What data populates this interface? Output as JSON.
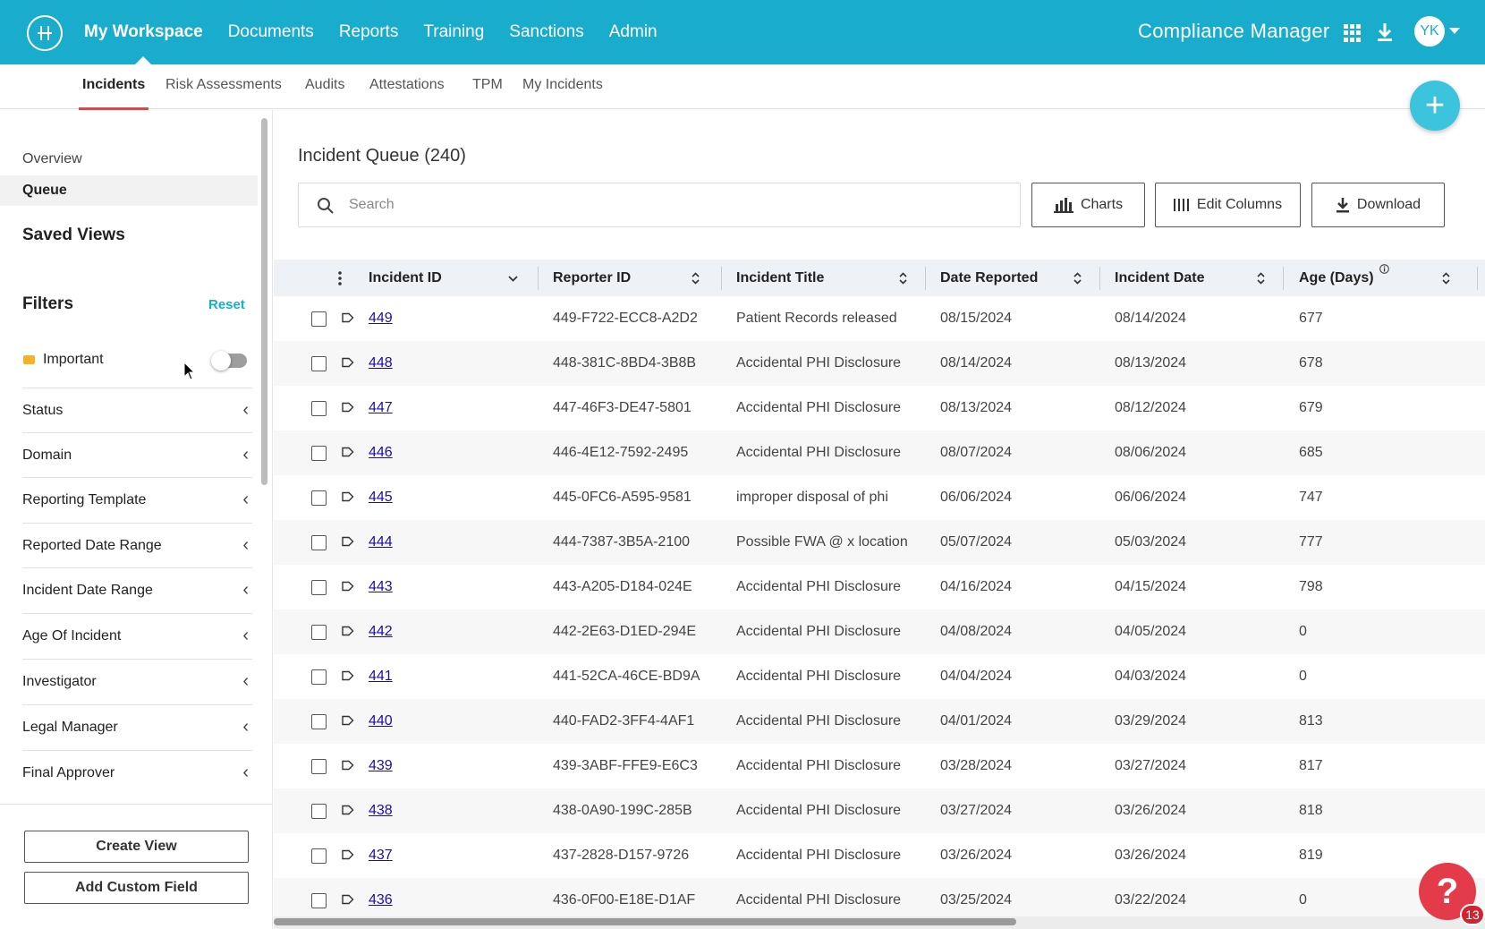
{
  "topnav": {
    "items": [
      "My Workspace",
      "Documents",
      "Reports",
      "Training",
      "Sanctions",
      "Admin"
    ],
    "brand": "Compliance Manager",
    "avatar_initials": "YK",
    "accent_color": "#1aaccd"
  },
  "subnav": {
    "items": [
      "Incidents",
      "Risk Assessments",
      "Audits",
      "Attestations",
      "TPM",
      "My Incidents"
    ],
    "active": "Incidents",
    "fab_symbol": "+"
  },
  "sidebar": {
    "overview": "Overview",
    "queue": "Queue",
    "saved_views": "Saved Views",
    "filters": "Filters",
    "reset": "Reset",
    "important": "Important",
    "important_on": false,
    "filter_items": [
      "Status",
      "Domain",
      "Reporting Template",
      "Reported Date Range",
      "Incident Date Range",
      "Age Of Incident",
      "Investigator",
      "Legal Manager",
      "Final Approver"
    ],
    "create_view": "Create View",
    "add_custom_field": "Add Custom Field"
  },
  "main": {
    "title": "Incident Queue (240)",
    "search_placeholder": "Search",
    "charts": "Charts",
    "edit_columns": "Edit Columns",
    "download": "Download"
  },
  "table": {
    "columns": [
      "Incident ID",
      "Reporter ID",
      "Incident Title",
      "Date Reported",
      "Incident Date",
      "Age (Days)"
    ],
    "rows": [
      {
        "id": "449",
        "reporter": "449-F722-ECC8-A2D2",
        "title": "Patient Records released",
        "reported": "08/15/2024",
        "incident": "08/14/2024",
        "age": "677"
      },
      {
        "id": "448",
        "reporter": "448-381C-8BD4-3B8B",
        "title": "Accidental PHI Disclosure",
        "reported": "08/14/2024",
        "incident": "08/13/2024",
        "age": "678"
      },
      {
        "id": "447",
        "reporter": "447-46F3-DE47-5801",
        "title": "Accidental PHI Disclosure",
        "reported": "08/13/2024",
        "incident": "08/12/2024",
        "age": "679"
      },
      {
        "id": "446",
        "reporter": "446-4E12-7592-2495",
        "title": "Accidental PHI Disclosure",
        "reported": "08/07/2024",
        "incident": "08/06/2024",
        "age": "685"
      },
      {
        "id": "445",
        "reporter": "445-0FC6-A595-9581",
        "title": "improper disposal of phi",
        "reported": "06/06/2024",
        "incident": "06/06/2024",
        "age": "747"
      },
      {
        "id": "444",
        "reporter": "444-7387-3B5A-2100",
        "title": "Possible FWA @ x location",
        "reported": "05/07/2024",
        "incident": "05/03/2024",
        "age": "777"
      },
      {
        "id": "443",
        "reporter": "443-A205-D184-024E",
        "title": "Accidental PHI Disclosure",
        "reported": "04/16/2024",
        "incident": "04/15/2024",
        "age": "798"
      },
      {
        "id": "442",
        "reporter": "442-2E63-D1ED-294E",
        "title": "Accidental PHI Disclosure",
        "reported": "04/08/2024",
        "incident": "04/05/2024",
        "age": "0"
      },
      {
        "id": "441",
        "reporter": "441-52CA-46CE-BD9A",
        "title": "Accidental PHI Disclosure",
        "reported": "04/04/2024",
        "incident": "04/03/2024",
        "age": "0"
      },
      {
        "id": "440",
        "reporter": "440-FAD2-3FF4-4AF1",
        "title": "Accidental PHI Disclosure",
        "reported": "04/01/2024",
        "incident": "03/29/2024",
        "age": "813"
      },
      {
        "id": "439",
        "reporter": "439-3ABF-FFE9-E6C3",
        "title": "Accidental PHI Disclosure",
        "reported": "03/28/2024",
        "incident": "03/27/2024",
        "age": "817"
      },
      {
        "id": "438",
        "reporter": "438-0A90-199C-285B",
        "title": "Accidental PHI Disclosure",
        "reported": "03/27/2024",
        "incident": "03/26/2024",
        "age": "818"
      },
      {
        "id": "437",
        "reporter": "437-2828-D157-9726",
        "title": "Accidental PHI Disclosure",
        "reported": "03/26/2024",
        "incident": "03/26/2024",
        "age": "819"
      },
      {
        "id": "436",
        "reporter": "436-0F00-E18E-D1AF",
        "title": "Accidental PHI Disclosure",
        "reported": "03/25/2024",
        "incident": "03/22/2024",
        "age": "0"
      }
    ]
  },
  "help": {
    "symbol": "?",
    "badge": "13"
  }
}
